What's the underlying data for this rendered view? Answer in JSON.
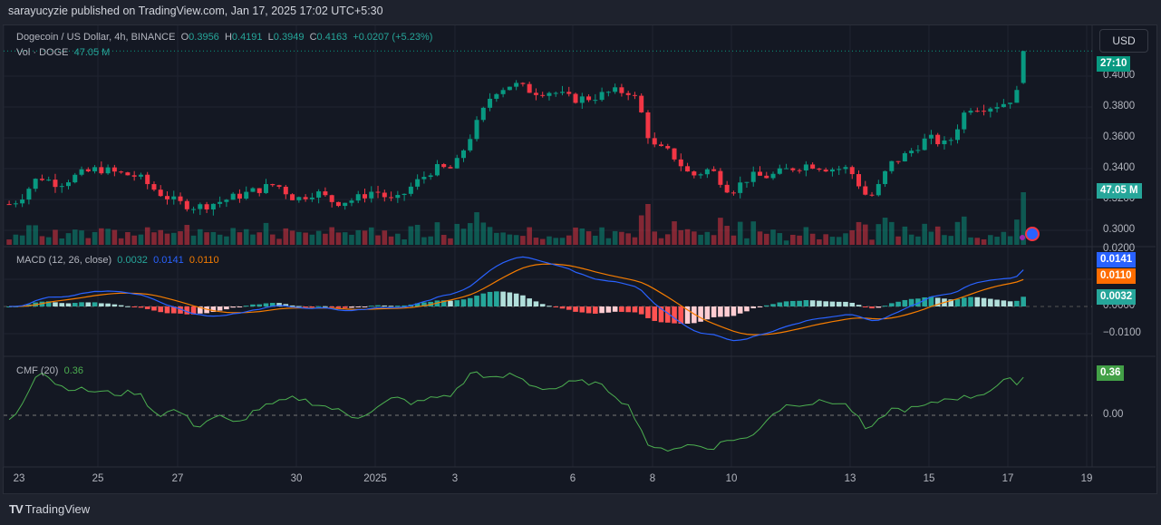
{
  "published": "sarayucyzie published on TradingView.com, Jan 17, 2025 17:02 UTC+5:30",
  "symbol": {
    "name": "Dogecoin / US Dollar, 4h, BINANCE",
    "o_label": "O",
    "o": "0.3956",
    "h_label": "H",
    "h": "0.4191",
    "l_label": "L",
    "l": "0.3949",
    "c_label": "C",
    "c": "0.4163",
    "change": "+0.0207 (+5.23%)"
  },
  "volume": {
    "label": "Vol · DOGE",
    "value": "47.05 M"
  },
  "currency": "USD",
  "countdown": "27:10",
  "price_axis": [
    "0.4000",
    "0.3800",
    "0.3600",
    "0.3400",
    "0.3200",
    "0.3000",
    "0.0200"
  ],
  "macd": {
    "label": "MACD (12, 26, close)",
    "hist": "0.0032",
    "macd": "0.0141",
    "signal": "0.0110",
    "axis": [
      "0.0000",
      "−0.0100"
    ]
  },
  "cmf": {
    "label": "CMF (20)",
    "value": "0.36",
    "axis": [
      "0.00"
    ]
  },
  "time_axis": [
    "23",
    "25",
    "27",
    "30",
    "2025",
    "3",
    "6",
    "8",
    "10",
    "13",
    "15",
    "17",
    "19"
  ],
  "brand": "TradingView",
  "colors": {
    "up": "#089981",
    "down": "#f23645",
    "macd": "#2962ff",
    "signal": "#f57c00",
    "cmf": "#4caf50"
  },
  "chart_data": {
    "type": "candlestick",
    "title": "Dogecoin / US Dollar, 4h, BINANCE",
    "x_unit": "days since Dec 23, 2024",
    "ylim": [
      0.29,
      0.42
    ],
    "price_points": [
      [
        -0.25,
        0.317
      ],
      [
        0,
        0.32
      ],
      [
        0.5,
        0.335
      ],
      [
        1,
        0.33
      ],
      [
        1.5,
        0.336
      ],
      [
        2,
        0.34
      ],
      [
        2.5,
        0.337
      ],
      [
        3,
        0.335
      ],
      [
        3.5,
        0.325
      ],
      [
        4,
        0.318
      ],
      [
        4.5,
        0.315
      ],
      [
        5,
        0.318
      ],
      [
        5.5,
        0.322
      ],
      [
        6,
        0.326
      ],
      [
        6.5,
        0.33
      ],
      [
        7,
        0.32
      ],
      [
        7.5,
        0.325
      ],
      [
        8,
        0.318
      ],
      [
        8.5,
        0.32
      ],
      [
        9,
        0.326
      ],
      [
        9.5,
        0.318
      ],
      [
        10,
        0.33
      ],
      [
        10.5,
        0.34
      ],
      [
        11,
        0.34
      ],
      [
        11.5,
        0.365
      ],
      [
        12,
        0.39
      ],
      [
        12.5,
        0.395
      ],
      [
        13,
        0.39
      ],
      [
        13.5,
        0.39
      ],
      [
        14,
        0.385
      ],
      [
        14.5,
        0.386
      ],
      [
        15,
        0.39
      ],
      [
        15.5,
        0.39
      ],
      [
        15.7,
        0.38
      ],
      [
        16,
        0.355
      ],
      [
        16.5,
        0.35
      ],
      [
        17,
        0.335
      ],
      [
        17.5,
        0.34
      ],
      [
        18,
        0.325
      ],
      [
        18.5,
        0.335
      ],
      [
        19,
        0.335
      ],
      [
        19.5,
        0.34
      ],
      [
        20,
        0.343
      ],
      [
        20.5,
        0.34
      ],
      [
        21,
        0.34
      ],
      [
        21.5,
        0.32
      ],
      [
        21.8,
        0.33
      ],
      [
        22,
        0.342
      ],
      [
        22.5,
        0.35
      ],
      [
        23,
        0.36
      ],
      [
        23.5,
        0.355
      ],
      [
        24,
        0.38
      ],
      [
        24.5,
        0.38
      ],
      [
        25,
        0.383
      ],
      [
        25.3,
        0.39
      ],
      [
        25.5,
        0.4163
      ]
    ],
    "cmf_points": [
      [
        -0.25,
        -0.05
      ],
      [
        0,
        0.05
      ],
      [
        0.5,
        0.4
      ],
      [
        1,
        0.25
      ],
      [
        1.5,
        0.22
      ],
      [
        2,
        0.2
      ],
      [
        2.5,
        0.18
      ],
      [
        3,
        0.2
      ],
      [
        3.5,
        0.0
      ],
      [
        4,
        0.05
      ],
      [
        4.5,
        -0.1
      ],
      [
        5,
        0.0
      ],
      [
        5.5,
        -0.08
      ],
      [
        6,
        0.05
      ],
      [
        6.5,
        0.1
      ],
      [
        7,
        0.15
      ],
      [
        7.5,
        0.1
      ],
      [
        8,
        0.05
      ],
      [
        8.5,
        -0.02
      ],
      [
        9,
        0.05
      ],
      [
        9.5,
        0.15
      ],
      [
        10,
        0.1
      ],
      [
        10.5,
        0.15
      ],
      [
        11,
        0.18
      ],
      [
        11.5,
        0.38
      ],
      [
        12,
        0.3
      ],
      [
        12.5,
        0.35
      ],
      [
        13,
        0.25
      ],
      [
        13.5,
        0.22
      ],
      [
        14,
        0.28
      ],
      [
        14.5,
        0.28
      ],
      [
        15,
        0.2
      ],
      [
        15.5,
        0.05
      ],
      [
        16,
        -0.3
      ],
      [
        16.5,
        -0.28
      ],
      [
        17,
        -0.25
      ],
      [
        17.5,
        -0.28
      ],
      [
        18,
        -0.2
      ],
      [
        18.5,
        -0.2
      ],
      [
        19,
        0.0
      ],
      [
        19.5,
        0.1
      ],
      [
        20,
        0.1
      ],
      [
        20.5,
        0.12
      ],
      [
        21,
        0.08
      ],
      [
        21.5,
        -0.15
      ],
      [
        22,
        0.05
      ],
      [
        22.5,
        0.05
      ],
      [
        23,
        0.08
      ],
      [
        23.5,
        0.15
      ],
      [
        24,
        0.15
      ],
      [
        24.5,
        0.2
      ],
      [
        25,
        0.3
      ],
      [
        25.3,
        0.28
      ],
      [
        25.5,
        0.36
      ]
    ]
  }
}
